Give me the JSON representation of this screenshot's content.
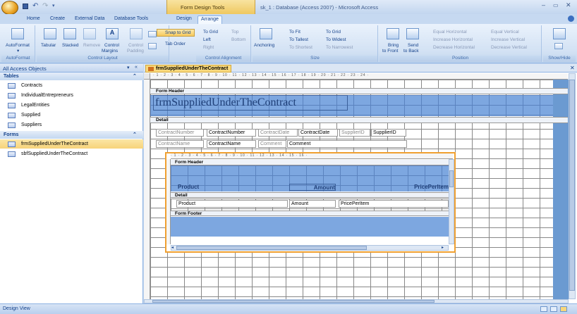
{
  "window": {
    "contextual_tab_group": "Form Design Tools",
    "title": "sk_1 : Database (Access 2007) - Microsoft Access",
    "qat_icons": [
      "save-icon",
      "undo-icon",
      "redo-icon",
      "customize-icon"
    ]
  },
  "ribbon_tabs": [
    "Home",
    "Create",
    "External Data",
    "Database Tools",
    "Design",
    "Arrange"
  ],
  "ribbon": {
    "groups": {
      "autoformat": "AutoFormat",
      "control_layout": "Control Layout",
      "control_alignment": "Control Alignment",
      "size": "Size",
      "position": "Position",
      "show_hide": "Show/Hide"
    },
    "buttons": {
      "autoformat": "AutoFormat",
      "tabular": "Tabular",
      "stacked": "Stacked",
      "remove": "Remove",
      "control_margins_1": "Control",
      "control_margins_2": "Margins",
      "control_padding_1": "Control",
      "control_padding_2": "Padding",
      "snap_to_grid": "Snap to Grid",
      "tab_order": "Tab Order",
      "to_grid": "To Grid",
      "top": "Top",
      "left": "Left",
      "bottom": "Bottom",
      "right": "Right",
      "anchoring": "Anchoring",
      "to_fit": "To Fit",
      "size_to_grid": "To Grid",
      "to_tallest": "To Tallest",
      "to_widest": "To Widest",
      "to_shortest": "To Shortest",
      "to_narrowest": "To Narrowest",
      "bring_to_front_1": "Bring",
      "bring_to_front_2": "to Front",
      "send_to_back_1": "Send",
      "send_to_back_2": "to Back",
      "equal_horizontal": "Equal Horizontal",
      "increase_horizontal": "Increase Horizontal",
      "decrease_horizontal": "Decrease Horizontal",
      "equal_vertical": "Equal Vertical",
      "increase_vertical": "Increase Vertical",
      "decrease_vertical": "Decrease Vertical"
    }
  },
  "nav": {
    "header": "All Access Objects",
    "sections": [
      {
        "title": "Tables",
        "items": [
          "Contracts",
          "IndividualEntrepreneurs",
          "LegalEntities",
          "Supplied",
          "Suppliers"
        ]
      },
      {
        "title": "Forms",
        "items": [
          "frmSuppliedUnderTheContract",
          "sbfSuppliedUnderTheContract"
        ]
      }
    ]
  },
  "document": {
    "tab_title": "frmSuppliedUnderTheContract",
    "ruler_text": "· 1 · 2 · 3 · 4 · 5 · 6 · 7 · 8 · 9 · 10 · 11 · 12 · 13 · 14 · 15 · 16 · 17 · 18 · 19 · 20 · 21 · 22 · 23 · 24 ·",
    "sections": {
      "form_header": "Form Header",
      "detail": "Detail",
      "form_footer": "Form Footer"
    },
    "form_title": "frmSuppliedUnderTheContract",
    "fields": {
      "contract_number_label": "ContractNumber",
      "contract_number": "ContractNumber",
      "contract_date_label": "ContractDate",
      "contract_date": "ContractDate",
      "supplier_id_label": "SupplierID",
      "supplier_id": "SupplierID",
      "contract_name_label": "ContractName",
      "contract_name": "ContractName",
      "comment_label": "Comment",
      "comment": "Comment"
    },
    "subform": {
      "ruler_text": "· 1 · 2 · 3 · 4 · 5 · 6 · 7 · 8 · 9 · 10 · 11 · 12 · 13 · 14 · 15 · 16 ·",
      "header_labels": [
        "Product",
        "Amount",
        "PricePerItem"
      ],
      "detail_fields": [
        "Product",
        "Amount",
        "PricePerItem"
      ]
    }
  },
  "status": {
    "view": "Design View"
  }
}
